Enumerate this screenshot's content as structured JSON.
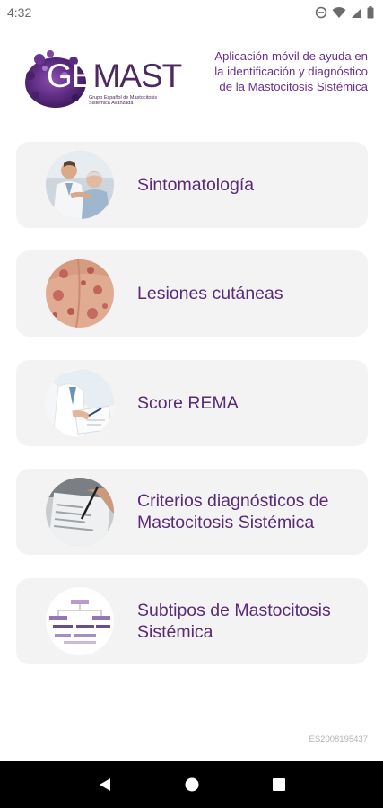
{
  "status_bar": {
    "time": "4:32",
    "icons": [
      "do-not-disturb-icon",
      "wifi-icon",
      "signal-icon",
      "battery-icon"
    ]
  },
  "header": {
    "logo": {
      "word_part1": "GE",
      "word_part2": "MAST",
      "subtitle_line1": "Grupo Español de Mastocitosis",
      "subtitle_line2": "Sistémica Avanzada"
    },
    "tagline": "Aplicación móvil de ayuda en la identificación y diagnóstico de la Mastocitosis Sistémica"
  },
  "menu": {
    "items": [
      {
        "label": "Sintomatología",
        "image": "doctor-patient-photo"
      },
      {
        "label": "Lesiones cutáneas",
        "image": "skin-lesions-photo"
      },
      {
        "label": "Score REMA",
        "image": "doctor-writing-photo"
      },
      {
        "label": "Criterios diagnósticos de Mastocitosis Sistémica",
        "image": "hand-writing-form-photo"
      },
      {
        "label": "Subtipos de Mastocitosis Sistémica",
        "image": "flowchart-diagram-thumbnail"
      }
    ]
  },
  "footer": {
    "code": "ES2008195437"
  },
  "nav_bar": {
    "buttons": [
      "back-icon",
      "home-icon",
      "recents-icon"
    ]
  },
  "colors": {
    "accent": "#5a2a78",
    "tagline": "#6a2f8e",
    "card_bg": "#f3f3f4",
    "logo_purple": "#4b2a5e"
  }
}
